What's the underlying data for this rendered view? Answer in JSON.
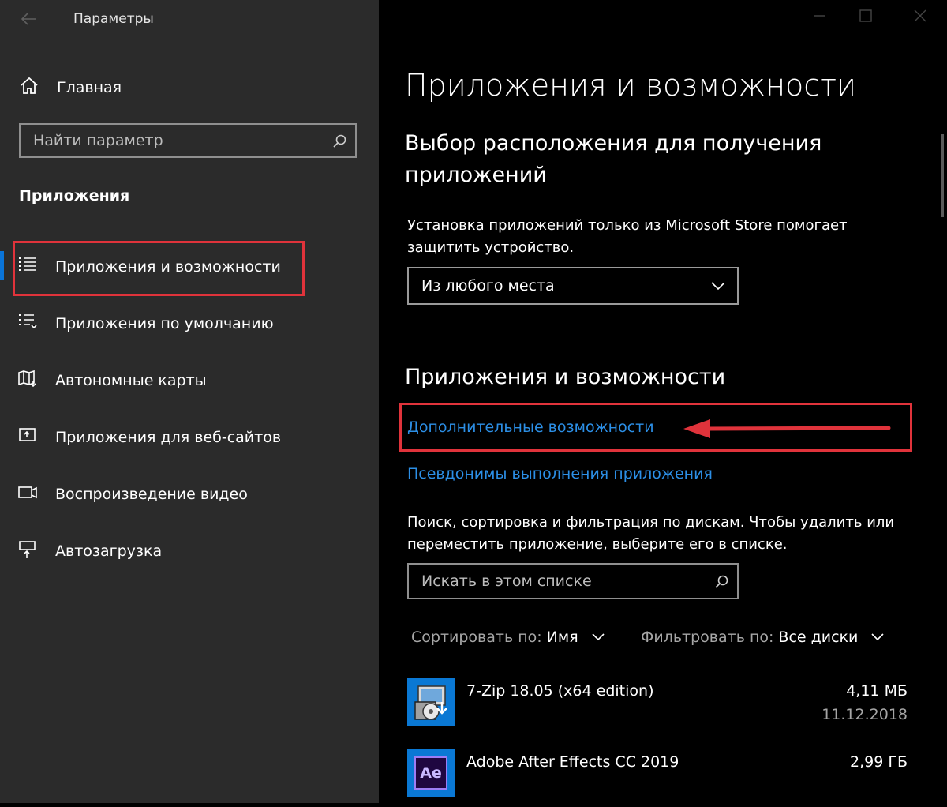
{
  "window": {
    "title": "Параметры",
    "back_icon": "back-arrow-icon"
  },
  "sidebar": {
    "home_label": "Главная",
    "search_placeholder": "Найти параметр",
    "section_title": "Приложения",
    "items": [
      {
        "label": "Приложения и возможности",
        "icon": "apps-features-icon",
        "selected": true
      },
      {
        "label": "Приложения по умолчанию",
        "icon": "default-apps-icon"
      },
      {
        "label": "Автономные карты",
        "icon": "offline-maps-icon"
      },
      {
        "label": "Приложения для веб-сайтов",
        "icon": "apps-for-websites-icon"
      },
      {
        "label": "Воспроизведение видео",
        "icon": "video-playback-icon"
      },
      {
        "label": "Автозагрузка",
        "icon": "startup-icon"
      }
    ]
  },
  "main": {
    "title": "Приложения и возможности",
    "install_section": {
      "heading": "Выбор расположения для получения приложений",
      "description": "Установка приложений только из Microsoft Store помогает защитить устройство.",
      "dropdown_value": "Из любого места"
    },
    "apps_section": {
      "heading": "Приложения и возможности",
      "link_optional": "Дополнительные возможности",
      "link_aliases": "Псевдонимы выполнения приложения",
      "description": "Поиск, сортировка и фильтрация по дискам. Чтобы удалить или переместить приложение, выберите его в списке.",
      "search_placeholder": "Искать в этом списке",
      "sort_label": "Сортировать по:",
      "sort_value": "Имя",
      "filter_label": "Фильтровать по:",
      "filter_value": "Все диски",
      "apps": [
        {
          "name": "7-Zip 18.05 (x64 edition)",
          "size": "4,11 МБ",
          "date": "11.12.2018"
        },
        {
          "name": "Adobe After Effects CC 2019",
          "size": "2,99 ГБ",
          "date": ""
        }
      ],
      "ae_icon_text": "Ae"
    }
  },
  "colors": {
    "accent": "#0a74d8",
    "link": "#2c8fe6",
    "highlight": "#e0333b"
  }
}
